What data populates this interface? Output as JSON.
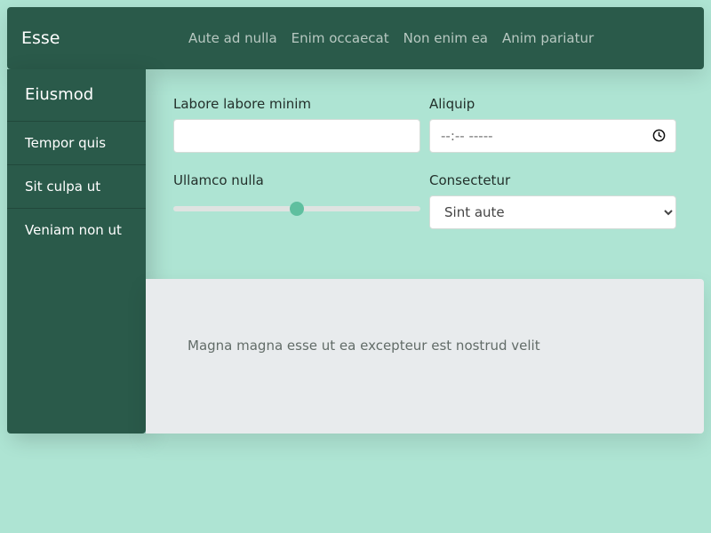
{
  "navbar": {
    "brand": "Esse",
    "links": [
      "Aute ad nulla",
      "Enim occaecat",
      "Non enim ea",
      "Anim pariatur"
    ]
  },
  "sidebar": {
    "heading": "Eiusmod",
    "items": [
      "Tempor quis",
      "Sit culpa ut",
      "Veniam non ut"
    ]
  },
  "form": {
    "field1": {
      "label": "Labore labore minim",
      "value": ""
    },
    "field2": {
      "label": "Aliquip",
      "placeholder": "--:-- -----"
    },
    "field3": {
      "label": "Ullamco nulla",
      "value": 0.5
    },
    "field4": {
      "label": "Consectetur",
      "selected": "Sint aute"
    }
  },
  "panel": {
    "text": "Magna magna esse ut ea excepteur est nostrud velit"
  },
  "colors": {
    "background": "#aee4d3",
    "nav": "#2a5a4a",
    "accent": "#5fbf9f",
    "panel": "#e8ebed"
  },
  "icons": {
    "time_field": "clock-icon",
    "select": "chevron-down-icon"
  }
}
